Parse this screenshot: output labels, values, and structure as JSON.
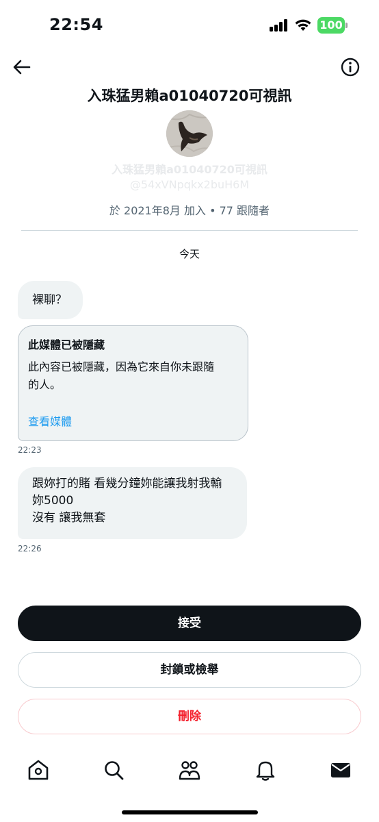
{
  "status_bar": {
    "time": "22:54",
    "battery": "100"
  },
  "header": {
    "title": "入珠猛男賴a01040720可視訊",
    "profile_name": "入珠猛男賴a01040720可視訊",
    "profile_handle": "@54xVNpqkx2buH6M",
    "profile_meta": "於 2021年8月 加入 • 77 跟隨者"
  },
  "date_separator": "今天",
  "messages": [
    {
      "text": "裸聊？"
    },
    {
      "hidden_media": {
        "title": "此媒體已被隱藏",
        "line1": "此內容已被隱藏，因為它來自你未跟隨",
        "line2": "的人。",
        "link": "查看媒體"
      },
      "time": "22:23"
    },
    {
      "lines": [
        "跟妳打的賭 看幾分鐘妳能讓我射我輸",
        "妳5000",
        "沒有 讓我無套"
      ],
      "time": "22:26"
    }
  ],
  "actions": {
    "accept": "接受",
    "block_report": "封鎖或檢舉",
    "delete": "刪除"
  },
  "tab_bar": [
    "home-icon",
    "search-icon",
    "communities-icon",
    "notifications-icon",
    "messages-icon"
  ],
  "colors": {
    "accent": "#1d9bf0",
    "danger": "#f4212e",
    "primary_button": "#0f1419",
    "bubble": "#eff3f4"
  }
}
